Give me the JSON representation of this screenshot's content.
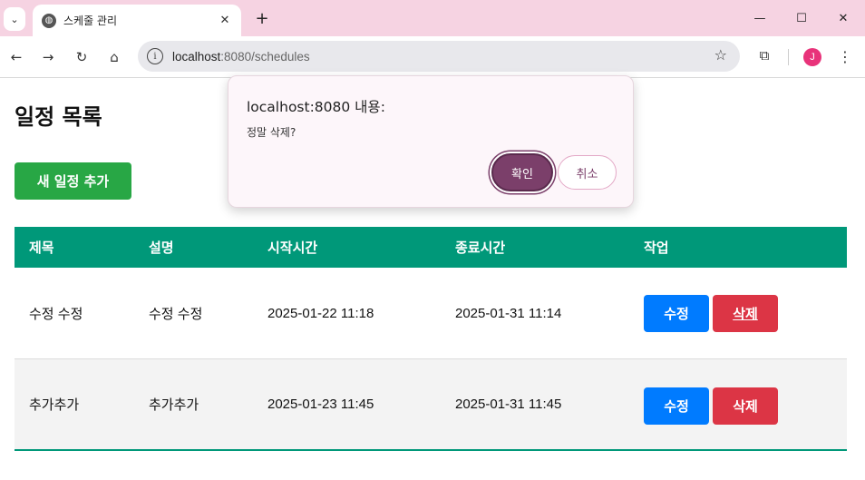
{
  "browser": {
    "tab_title": "스케줄 관리",
    "url_host": "localhost",
    "url_rest": ":8080/schedules",
    "avatar_initial": "J",
    "accent_color": "#f6d3e2"
  },
  "page": {
    "title": "일정 목록",
    "add_button": "새 일정 추가"
  },
  "table": {
    "headers": [
      "제목",
      "설명",
      "시작시간",
      "종료시간",
      "작업"
    ],
    "rows": [
      {
        "title": "수정 수정",
        "desc": "수정 수정",
        "start": "2025-01-22 11:18",
        "end": "2025-01-31 11:14",
        "edit": "수정",
        "delete": "삭제"
      },
      {
        "title": "추가추가",
        "desc": "추가추가",
        "start": "2025-01-23 11:45",
        "end": "2025-01-31 11:45",
        "edit": "수정",
        "delete": "삭제"
      }
    ],
    "header_color": "#009879",
    "edit_color": "#007bff",
    "delete_color": "#dc3545"
  },
  "dialog": {
    "title": "localhost:8080 내용:",
    "message": "정말 삭제?",
    "ok_label": "확인",
    "cancel_label": "취소"
  }
}
